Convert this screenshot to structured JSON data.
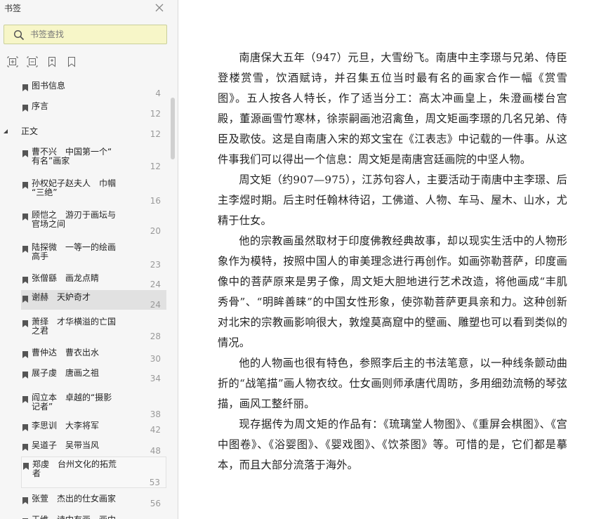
{
  "sidebar": {
    "title": "书签",
    "search": {
      "placeholder": "书签查找"
    },
    "toolbar": {
      "icons": [
        "expand-all-icon",
        "collapse-all-icon",
        "add-bookmark-icon",
        "bookmark-icon"
      ]
    },
    "items_top": [
      {
        "label": "图书信息",
        "page": "4"
      },
      {
        "label": "序言",
        "page": "12"
      }
    ],
    "section": {
      "label": "正文",
      "page": "12"
    },
    "items": [
      {
        "label": "曹不兴　中国第一个“\n有名”画家",
        "page": "12"
      },
      {
        "label": "孙权妃子赵夫人　巾帼\n“三绝”",
        "page": "16"
      },
      {
        "label": "顾恺之　游刃于画坛与\n官场之间",
        "page": "20"
      },
      {
        "label": "陆探微　一等一的绘画\n高手",
        "page": "23"
      },
      {
        "label": "张僧繇　画龙点睛",
        "page": "24"
      },
      {
        "label": "谢赫　天妒奇才",
        "page": "24"
      },
      {
        "label": "萧绎　才华横溢的亡国\n之君",
        "page": "28"
      },
      {
        "label": "曹仲达　曹衣出水",
        "page": "30"
      },
      {
        "label": "展子虔　唐画之祖",
        "page": "34"
      },
      {
        "label": "阎立本　卓越的“摄影\n记者”",
        "page": "38"
      },
      {
        "label": "李思训　大李将军",
        "page": "42"
      },
      {
        "label": "吴道子　吴带当风",
        "page": "48"
      },
      {
        "label": "郑虔　台州文化的拓荒\n者",
        "page": "53"
      },
      {
        "label": "张萱　杰出的仕女画家",
        "page": "56"
      },
      {
        "label": "王维　诗中有画，画中",
        "page": ""
      }
    ]
  },
  "article": {
    "paragraphs": [
      "南唐保大五年（947）元旦，大雪纷飞。南唐中主李璟与兄弟、侍臣登楼赏雪，饮酒赋诗，并召集五位当时最有名的画家合作一幅《赏雪图》。五人按各人特长，作了适当分工：高太冲画皇上，朱澄画楼台宫殿，董源画雪竹寒林，徐崇嗣画池沼禽鱼，周文矩画李璟的几名兄弟、侍臣及歌伎。这是自南唐入宋的郑文宝在《江表志》中记载的一件事。从这件事我们可以得出一个信息：周文矩是南唐宫廷画院的中坚人物。",
      "周文矩（约907—975），江苏句容人，主要活动于南唐中主李璟、后主李煜时期。后主时任翰林待诏，工佛道、人物、车马、屋木、山水，尤精于仕女。",
      "他的宗教画虽然取材于印度佛教经典故事，却以现实生活中的人物形象作为模特，按照中国人的审美理念进行再创作。如画弥勒菩萨，印度画像中的菩萨原来是男子像，周文矩大胆地进行艺术改造，将他画成“丰肌秀骨”、“明眸善睐”的中国女性形象，使弥勒菩萨更具亲和力。这种创新对北宋的宗教画影响很大，敦煌莫高窟中的壁画、雕塑也可以看到类似的情况。",
      "他的人物画也很有特色，参照李后主的书法笔意，以一种线条颤动曲折的“战笔描”画人物衣纹。仕女画则师承唐代周昉，多用细劲流畅的琴弦描，画风工整纤丽。",
      "现存据传为周文矩的作品有：《琉璃堂人物图》、《重屏会棋图》、《宫中图卷》、《浴婴图》、《婴戏图》、《饮茶图》等。可惜的是，它们都是摹本，而且大部分流落于海外。"
    ]
  },
  "colors": {
    "sidebar_bg": "#f6f6f6",
    "search_bg": "#f7f6c8",
    "selected_row": "#e1e1e1",
    "page_number": "#999999"
  }
}
